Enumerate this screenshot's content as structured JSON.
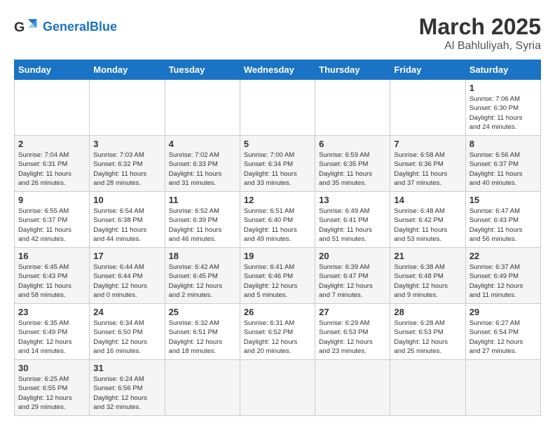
{
  "header": {
    "logo_general": "General",
    "logo_blue": "Blue",
    "month": "March 2025",
    "location": "Al Bahluliyah, Syria"
  },
  "weekdays": [
    "Sunday",
    "Monday",
    "Tuesday",
    "Wednesday",
    "Thursday",
    "Friday",
    "Saturday"
  ],
  "weeks": [
    [
      {
        "day": "",
        "info": ""
      },
      {
        "day": "",
        "info": ""
      },
      {
        "day": "",
        "info": ""
      },
      {
        "day": "",
        "info": ""
      },
      {
        "day": "",
        "info": ""
      },
      {
        "day": "",
        "info": ""
      },
      {
        "day": "1",
        "info": "Sunrise: 7:06 AM\nSunset: 6:30 PM\nDaylight: 11 hours\nand 24 minutes."
      }
    ],
    [
      {
        "day": "2",
        "info": "Sunrise: 7:04 AM\nSunset: 6:31 PM\nDaylight: 11 hours\nand 26 minutes."
      },
      {
        "day": "3",
        "info": "Sunrise: 7:03 AM\nSunset: 6:32 PM\nDaylight: 11 hours\nand 28 minutes."
      },
      {
        "day": "4",
        "info": "Sunrise: 7:02 AM\nSunset: 6:33 PM\nDaylight: 11 hours\nand 31 minutes."
      },
      {
        "day": "5",
        "info": "Sunrise: 7:00 AM\nSunset: 6:34 PM\nDaylight: 11 hours\nand 33 minutes."
      },
      {
        "day": "6",
        "info": "Sunrise: 6:59 AM\nSunset: 6:35 PM\nDaylight: 11 hours\nand 35 minutes."
      },
      {
        "day": "7",
        "info": "Sunrise: 6:58 AM\nSunset: 6:36 PM\nDaylight: 11 hours\nand 37 minutes."
      },
      {
        "day": "8",
        "info": "Sunrise: 6:56 AM\nSunset: 6:37 PM\nDaylight: 11 hours\nand 40 minutes."
      }
    ],
    [
      {
        "day": "9",
        "info": "Sunrise: 6:55 AM\nSunset: 6:37 PM\nDaylight: 11 hours\nand 42 minutes."
      },
      {
        "day": "10",
        "info": "Sunrise: 6:54 AM\nSunset: 6:38 PM\nDaylight: 11 hours\nand 44 minutes."
      },
      {
        "day": "11",
        "info": "Sunrise: 6:52 AM\nSunset: 6:39 PM\nDaylight: 11 hours\nand 46 minutes."
      },
      {
        "day": "12",
        "info": "Sunrise: 6:51 AM\nSunset: 6:40 PM\nDaylight: 11 hours\nand 49 minutes."
      },
      {
        "day": "13",
        "info": "Sunrise: 6:49 AM\nSunset: 6:41 PM\nDaylight: 11 hours\nand 51 minutes."
      },
      {
        "day": "14",
        "info": "Sunrise: 6:48 AM\nSunset: 6:42 PM\nDaylight: 11 hours\nand 53 minutes."
      },
      {
        "day": "15",
        "info": "Sunrise: 6:47 AM\nSunset: 6:43 PM\nDaylight: 11 hours\nand 56 minutes."
      }
    ],
    [
      {
        "day": "16",
        "info": "Sunrise: 6:45 AM\nSunset: 6:43 PM\nDaylight: 11 hours\nand 58 minutes."
      },
      {
        "day": "17",
        "info": "Sunrise: 6:44 AM\nSunset: 6:44 PM\nDaylight: 12 hours\nand 0 minutes."
      },
      {
        "day": "18",
        "info": "Sunrise: 6:42 AM\nSunset: 6:45 PM\nDaylight: 12 hours\nand 2 minutes."
      },
      {
        "day": "19",
        "info": "Sunrise: 6:41 AM\nSunset: 6:46 PM\nDaylight: 12 hours\nand 5 minutes."
      },
      {
        "day": "20",
        "info": "Sunrise: 6:39 AM\nSunset: 6:47 PM\nDaylight: 12 hours\nand 7 minutes."
      },
      {
        "day": "21",
        "info": "Sunrise: 6:38 AM\nSunset: 6:48 PM\nDaylight: 12 hours\nand 9 minutes."
      },
      {
        "day": "22",
        "info": "Sunrise: 6:37 AM\nSunset: 6:49 PM\nDaylight: 12 hours\nand 11 minutes."
      }
    ],
    [
      {
        "day": "23",
        "info": "Sunrise: 6:35 AM\nSunset: 6:49 PM\nDaylight: 12 hours\nand 14 minutes."
      },
      {
        "day": "24",
        "info": "Sunrise: 6:34 AM\nSunset: 6:50 PM\nDaylight: 12 hours\nand 16 minutes."
      },
      {
        "day": "25",
        "info": "Sunrise: 6:32 AM\nSunset: 6:51 PM\nDaylight: 12 hours\nand 18 minutes."
      },
      {
        "day": "26",
        "info": "Sunrise: 6:31 AM\nSunset: 6:52 PM\nDaylight: 12 hours\nand 20 minutes."
      },
      {
        "day": "27",
        "info": "Sunrise: 6:29 AM\nSunset: 6:53 PM\nDaylight: 12 hours\nand 23 minutes."
      },
      {
        "day": "28",
        "info": "Sunrise: 6:28 AM\nSunset: 6:53 PM\nDaylight: 12 hours\nand 25 minutes."
      },
      {
        "day": "29",
        "info": "Sunrise: 6:27 AM\nSunset: 6:54 PM\nDaylight: 12 hours\nand 27 minutes."
      }
    ],
    [
      {
        "day": "30",
        "info": "Sunrise: 6:25 AM\nSunset: 6:55 PM\nDaylight: 12 hours\nand 29 minutes."
      },
      {
        "day": "31",
        "info": "Sunrise: 6:24 AM\nSunset: 6:56 PM\nDaylight: 12 hours\nand 32 minutes."
      },
      {
        "day": "",
        "info": ""
      },
      {
        "day": "",
        "info": ""
      },
      {
        "day": "",
        "info": ""
      },
      {
        "day": "",
        "info": ""
      },
      {
        "day": "",
        "info": ""
      }
    ]
  ]
}
